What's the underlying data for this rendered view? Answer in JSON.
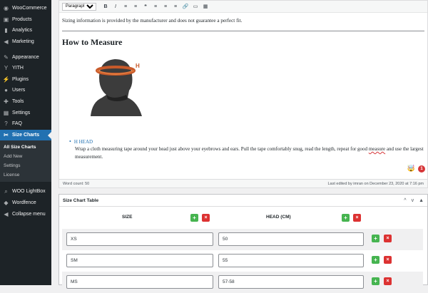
{
  "sidebar": {
    "items": [
      {
        "label": "WooCommerce",
        "icon": "woo-icon"
      },
      {
        "label": "Products",
        "icon": "box-icon"
      },
      {
        "label": "Analytics",
        "icon": "bar-chart-icon"
      },
      {
        "label": "Marketing",
        "icon": "megaphone-icon"
      },
      {
        "label": "Appearance",
        "icon": "paintbrush-icon"
      },
      {
        "label": "YITH",
        "icon": "yith-icon"
      },
      {
        "label": "Plugins",
        "icon": "plug-icon"
      },
      {
        "label": "Users",
        "icon": "user-icon"
      },
      {
        "label": "Tools",
        "icon": "wrench-icon"
      },
      {
        "label": "Settings",
        "icon": "settings-icon"
      },
      {
        "label": "FAQ",
        "icon": "help-icon"
      },
      {
        "label": "Size Charts",
        "icon": "ruler-icon"
      }
    ],
    "submenu": [
      "All Size Charts",
      "Add New",
      "Settings",
      "License"
    ],
    "bottom": [
      {
        "label": "WOO LightBox",
        "icon": "search-icon"
      },
      {
        "label": "Wordfence",
        "icon": "wordfence-icon"
      },
      {
        "label": "Collapse menu",
        "icon": "collapse-icon"
      }
    ]
  },
  "editor": {
    "format_select": "Paragraph",
    "toolbar": [
      "B",
      "I",
      "≡",
      "≡",
      "❝",
      "≡",
      "≡",
      "≡",
      "🔗",
      "▭",
      "▦"
    ],
    "note": "Sizing information is provided by the manufacturer and does not guarantee a perfect fit.",
    "heading": "How to Measure",
    "illus_letter": "H",
    "list_title": "H HEAD",
    "desc_start": "Wrap a cloth measuring tape around your head just above your eyebrows and ears. Pull the tape comfortably snug, read the length, repeat for good ",
    "desc_misspelt": "measure",
    "desc_end": " and use the largest measurement.",
    "emoji": "🤯",
    "badge": "1",
    "word_count": "Word count: 50",
    "last_edited": "Last edited by imran on December 23, 2020 at 7:16 pm"
  },
  "size_table": {
    "title": "Size Chart Table",
    "controls": [
      "^",
      "v",
      "▲"
    ],
    "columns": [
      "SIZE",
      "HEAD (CM)"
    ],
    "add_label": "+",
    "del_label": "×",
    "rows": [
      [
        "XS",
        "50"
      ],
      [
        "SM",
        "55"
      ],
      [
        "MS",
        "57-58"
      ]
    ]
  },
  "colors": {
    "sidebar_bg": "#1d2327",
    "accent": "#2271b1",
    "add": "#46b450",
    "delete": "#dc3232"
  }
}
